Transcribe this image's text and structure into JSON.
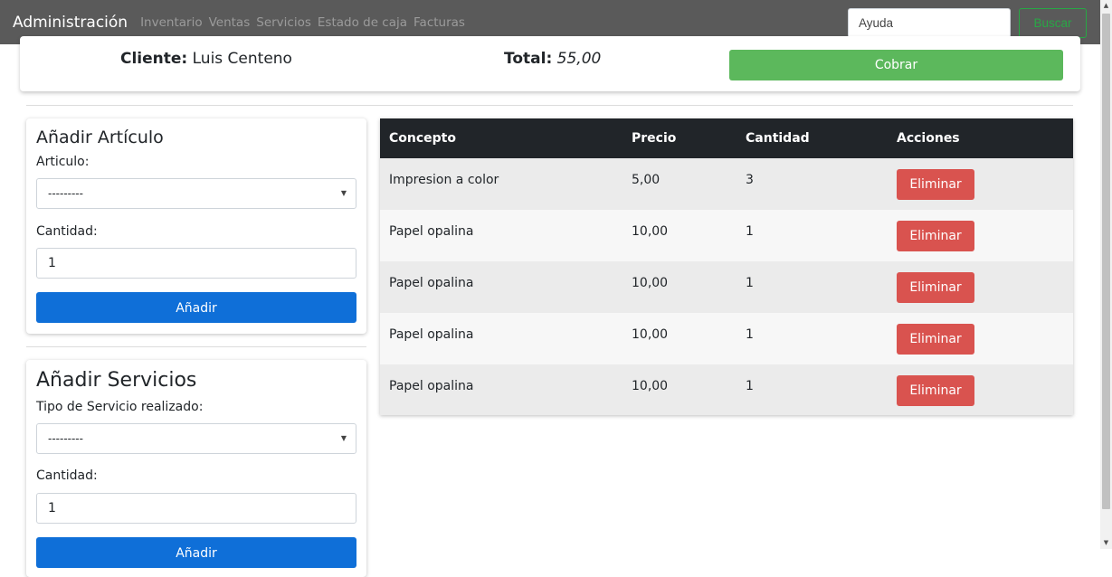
{
  "navbar": {
    "brand": "Administración",
    "links": [
      "Inventario",
      "Ventas",
      "Servicios",
      "Estado de caja",
      "Facturas"
    ],
    "search_placeholder": "Ayuda",
    "search_button": "Buscar"
  },
  "summary": {
    "client_label": "Cliente:",
    "client_name": "Luis Centeno",
    "total_label": "Total:",
    "total_value": "55,00",
    "charge_button": "Cobrar"
  },
  "articulo_panel": {
    "title": "Añadir Artículo",
    "article_label": "Articulo:",
    "article_selected": "---------",
    "quantity_label": "Cantidad:",
    "quantity_value": "1",
    "add_button": "Añadir"
  },
  "servicios_panel": {
    "title": "Añadir Servicios",
    "type_label": "Tipo de Servicio realizado:",
    "type_selected": "---------",
    "quantity_label": "Cantidad:",
    "quantity_value": "1",
    "add_button": "Añadir"
  },
  "table": {
    "headers": [
      "Concepto",
      "Precio",
      "Cantidad",
      "Acciones"
    ],
    "rows": [
      {
        "concepto": "Impresion a color",
        "precio": "5,00",
        "cantidad": "3",
        "action": "Eliminar"
      },
      {
        "concepto": "Papel opalina",
        "precio": "10,00",
        "cantidad": "1",
        "action": "Eliminar"
      },
      {
        "concepto": "Papel opalina",
        "precio": "10,00",
        "cantidad": "1",
        "action": "Eliminar"
      },
      {
        "concepto": "Papel opalina",
        "precio": "10,00",
        "cantidad": "1",
        "action": "Eliminar"
      },
      {
        "concepto": "Papel opalina",
        "precio": "10,00",
        "cantidad": "1",
        "action": "Eliminar"
      }
    ]
  },
  "colors": {
    "navbar": "#5a5a5a",
    "success": "#5cb85c",
    "primary": "#0f6fd8",
    "danger": "#d9534f",
    "table_header": "#212529"
  }
}
